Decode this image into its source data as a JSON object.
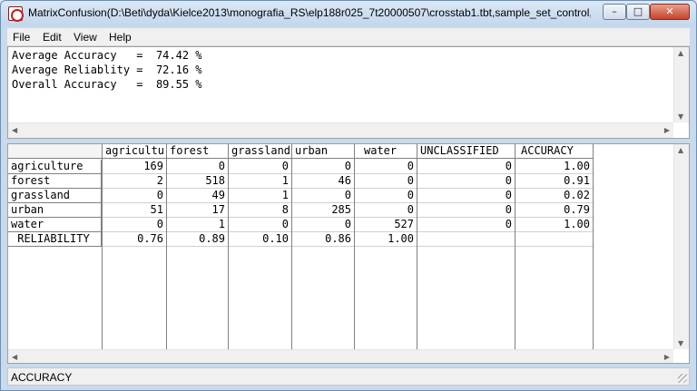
{
  "window": {
    "title": "MatrixConfusion(D:\\Beti\\dyda\\Kielce2013\\monografia_RS\\elp188r025_7t20000507\\crosstab1.tbt,sample_set_control,...",
    "controls": {
      "minimize": "–",
      "maximize": "□",
      "close": "✕"
    }
  },
  "menu": [
    {
      "label": "File"
    },
    {
      "label": "Edit"
    },
    {
      "label": "View"
    },
    {
      "label": "Help"
    }
  ],
  "summary": {
    "lines": [
      "Average Accuracy   =  74.42 %",
      "Average Reliablity =  72.16 %",
      "Overall Accuracy   =  89.55 %"
    ]
  },
  "matrix": {
    "columns": [
      "agriculture",
      "forest",
      "grassland",
      "urban",
      "water",
      "UNCLASSIFIED",
      "ACCURACY"
    ],
    "rows": [
      {
        "label": "agriculture",
        "values": [
          "169",
          "0",
          "0",
          "0",
          "0",
          "0",
          "1.00"
        ]
      },
      {
        "label": "forest",
        "values": [
          "2",
          "518",
          "1",
          "46",
          "0",
          "0",
          "0.91"
        ]
      },
      {
        "label": "grassland",
        "values": [
          "0",
          "49",
          "1",
          "0",
          "0",
          "0",
          "0.02"
        ]
      },
      {
        "label": "urban",
        "values": [
          "51",
          "17",
          "8",
          "285",
          "0",
          "0",
          "0.79"
        ]
      },
      {
        "label": "water",
        "values": [
          "0",
          "1",
          "0",
          "0",
          "527",
          "0",
          "1.00"
        ]
      },
      {
        "label": " RELIABILITY",
        "values": [
          "0.76",
          "0.89",
          "0.10",
          "0.86",
          "1.00",
          "",
          ""
        ]
      }
    ]
  },
  "status": {
    "text": "ACCURACY"
  }
}
